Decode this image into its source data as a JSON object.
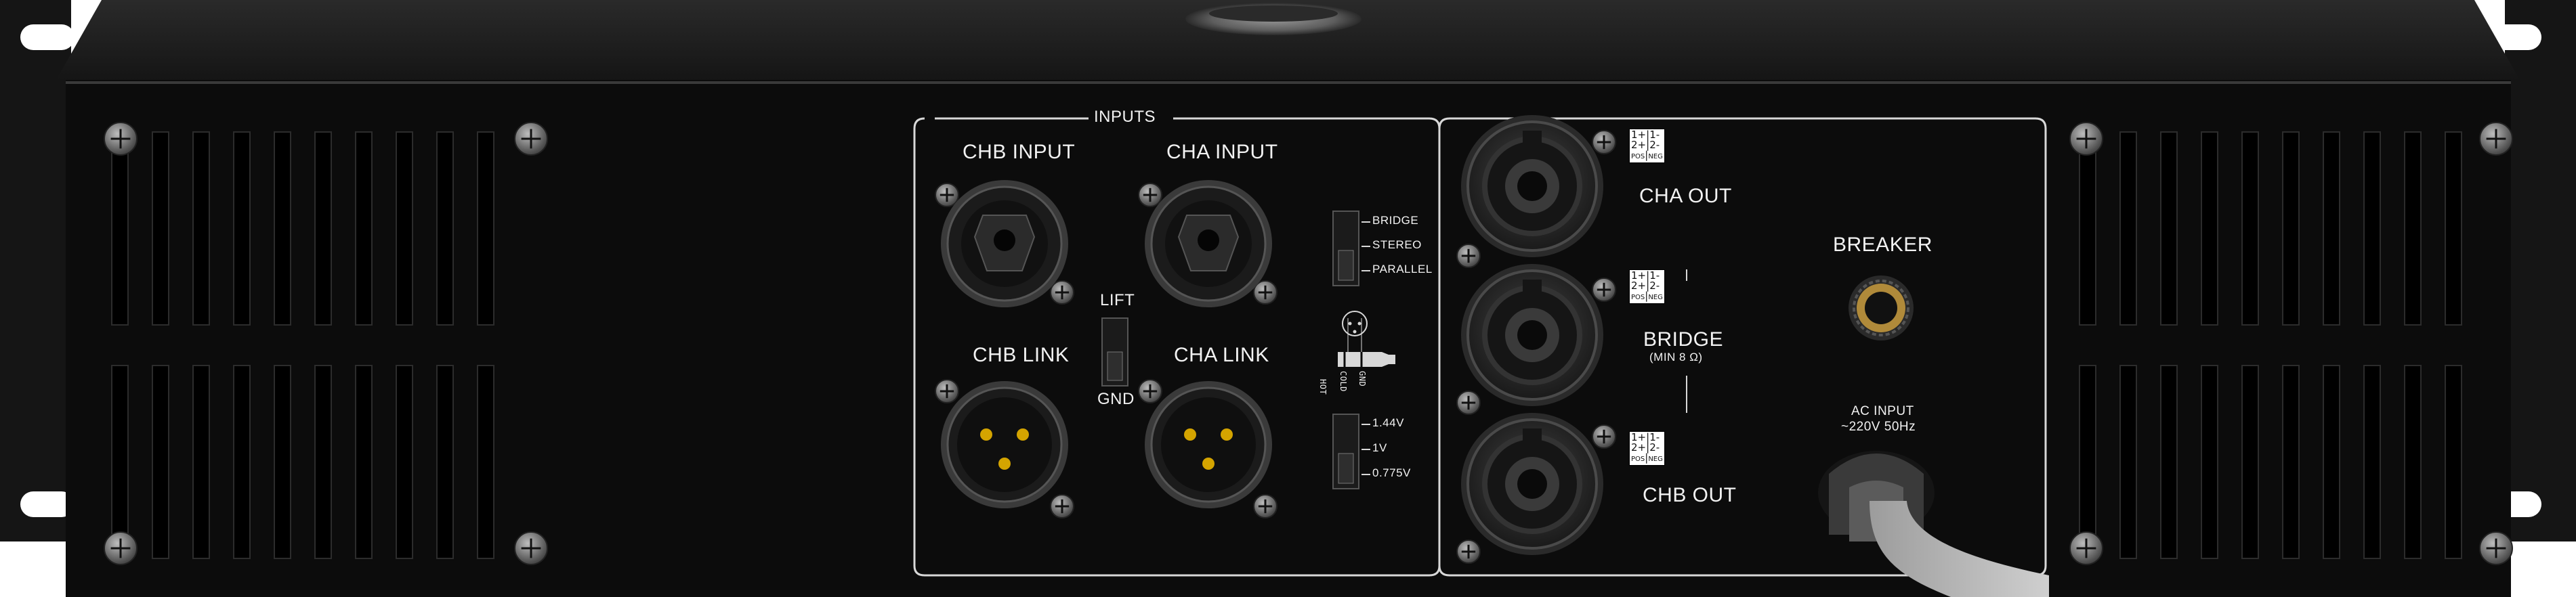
{
  "inputs": {
    "section_title": "INPUTS",
    "chb_input": "CHB INPUT",
    "cha_input": "CHA INPUT",
    "chb_link": "CHB LINK",
    "cha_link": "CHA LINK",
    "ground_switch": {
      "top": "LIFT",
      "bottom": "GND"
    },
    "mode_switch": [
      "BRIDGE",
      "STEREO",
      "PARALLEL"
    ],
    "sensitivity_switch": [
      "1.44V",
      "1V",
      "0.775V"
    ],
    "xlr_diagram_labels": [
      "HOT",
      "COLD",
      "GND"
    ]
  },
  "outputs": {
    "cha_out": "CHA OUT",
    "bridge": "BRIDGE",
    "bridge_note": "(MIN 8 Ω)",
    "chb_out": "CHB OUT",
    "pin_labels": {
      "row1": [
        "1+",
        "1-"
      ],
      "row2": [
        "2+",
        "2-"
      ],
      "row3": [
        "POS",
        "NEG"
      ]
    }
  },
  "power": {
    "breaker": "BREAKER",
    "ac_input_line1": "AC INPUT",
    "ac_input_line2": "~220V  50Hz"
  },
  "colors": {
    "chassis": "#0c0c0c",
    "chassis_top": "#1e1e1e",
    "rack_ear": "#131313",
    "panel_line": "#d8d8d8",
    "label_text": "#f2f2f2",
    "gold_pin": "#d4a400",
    "screw": "#8a8a8a"
  }
}
